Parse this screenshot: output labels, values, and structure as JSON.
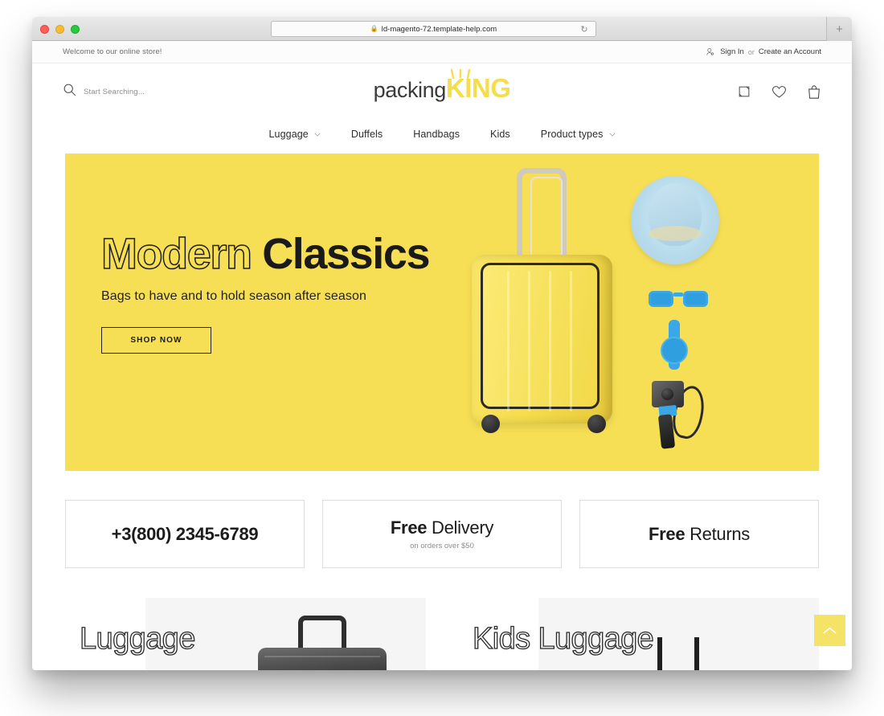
{
  "browser": {
    "url": "ld-magento-72.template-help.com",
    "lock_icon": "lock-icon",
    "reload_icon": "reload-icon",
    "new_tab_label": "+",
    "traffic_lights": [
      "close",
      "minimize",
      "maximize"
    ]
  },
  "topbar": {
    "welcome": "Welcome to our online store!",
    "sign_in": "Sign In",
    "separator": "or",
    "create_account": "Create an Account",
    "account_icon": "person-icon"
  },
  "header": {
    "search_placeholder": "Start Searching...",
    "search_icon": "search-icon",
    "logo": {
      "part1": "packing",
      "part2": "KING",
      "crown_icon": "crown-icon",
      "accent_color": "#f5dd4b"
    },
    "icons": [
      {
        "name": "compare-icon",
        "label": "Compare"
      },
      {
        "name": "wishlist-heart-icon",
        "label": "Wishlist"
      },
      {
        "name": "cart-bag-icon",
        "label": "Cart"
      }
    ]
  },
  "nav": {
    "items": [
      {
        "label": "Luggage",
        "has_dropdown": true
      },
      {
        "label": "Duffels",
        "has_dropdown": false
      },
      {
        "label": "Handbags",
        "has_dropdown": false
      },
      {
        "label": "Kids",
        "has_dropdown": false
      },
      {
        "label": "Product types",
        "has_dropdown": true
      }
    ]
  },
  "hero": {
    "title_outline": "Modern",
    "title_solid": "Classics",
    "subtitle": "Bags to have and to hold season after season",
    "cta": "SHOP NOW",
    "background_color": "#f7df55",
    "artwork": [
      "yellow-suitcase",
      "blue-fedora-hat",
      "blue-sunglasses",
      "blue-watch",
      "action-camera"
    ]
  },
  "features": [
    {
      "main_bold": "+3(800) 2345-6789",
      "main_light": "",
      "sub": ""
    },
    {
      "main_bold": "Free",
      "main_light": " Delivery",
      "sub": "on orders over $50"
    },
    {
      "main_bold": "Free",
      "main_light": " Returns",
      "sub": ""
    }
  ],
  "categories": [
    {
      "label": "Luggage",
      "image": "black-rolling-suitcase"
    },
    {
      "label": "Kids Luggage",
      "image": "kids-bag-straps"
    }
  ],
  "scroll_top": {
    "icon": "chevron-up-icon",
    "background_color": "#f5e367"
  }
}
